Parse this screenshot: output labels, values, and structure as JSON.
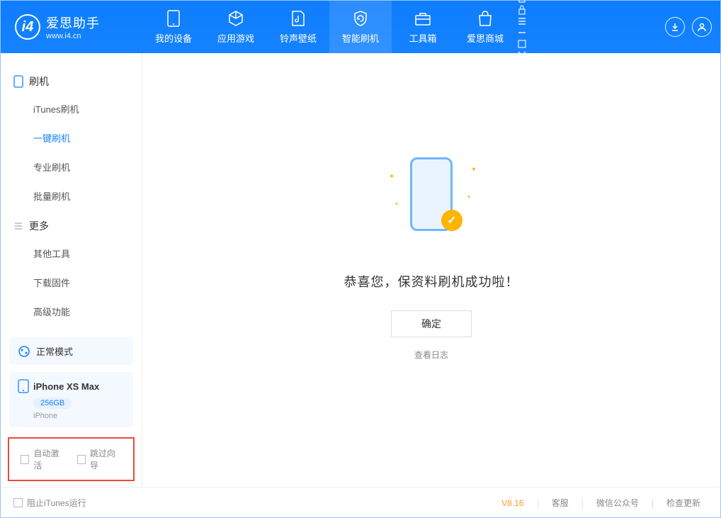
{
  "app": {
    "name": "爱思助手",
    "url": "www.i4.cn"
  },
  "nav": [
    {
      "label": "我的设备"
    },
    {
      "label": "应用游戏"
    },
    {
      "label": "铃声壁纸"
    },
    {
      "label": "智能刷机"
    },
    {
      "label": "工具箱"
    },
    {
      "label": "爱思商城"
    }
  ],
  "sidebar": {
    "section1": {
      "title": "刷机"
    },
    "items1": [
      {
        "label": "iTunes刷机"
      },
      {
        "label": "一键刷机"
      },
      {
        "label": "专业刷机"
      },
      {
        "label": "批量刷机"
      }
    ],
    "section2": {
      "title": "更多"
    },
    "items2": [
      {
        "label": "其他工具"
      },
      {
        "label": "下载固件"
      },
      {
        "label": "高级功能"
      }
    ]
  },
  "mode": {
    "label": "正常模式"
  },
  "device": {
    "name": "iPhone XS Max",
    "storage": "256GB",
    "type": "iPhone"
  },
  "options": {
    "auto_activate": "自动激活",
    "skip_guide": "跳过向导"
  },
  "main": {
    "message": "恭喜您，保资料刷机成功啦！",
    "ok": "确定",
    "log": "查看日志"
  },
  "footer": {
    "block_itunes": "阻止iTunes运行",
    "version": "V8.16",
    "support": "客服",
    "wechat": "微信公众号",
    "update": "检查更新"
  }
}
